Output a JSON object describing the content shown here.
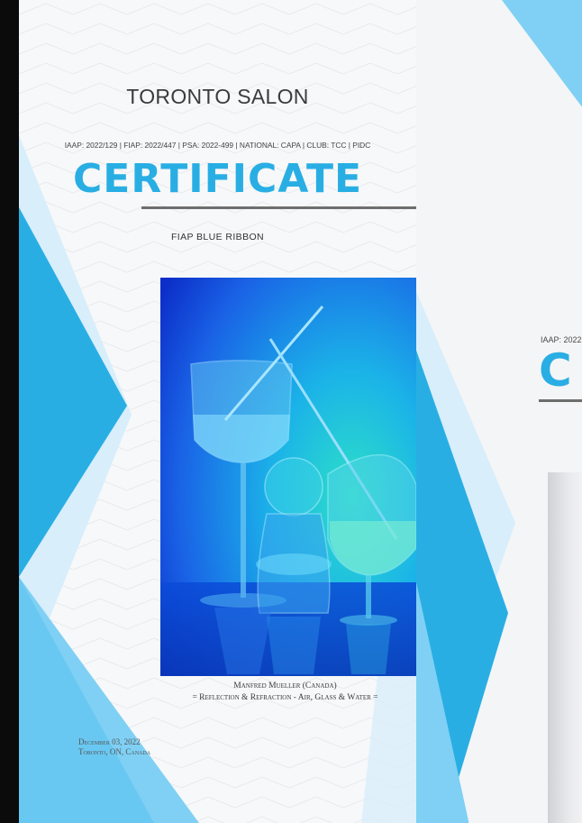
{
  "front_certificate": {
    "salon_name": "TORONTO SALON",
    "accreditations": "IAAP: 2022/129 | FIAP: 2022/447 | PSA: 2022-499 | NATIONAL: CAPA | CLUB: TCC | PIDC",
    "heading": "CERTIFICATE",
    "award": "FIAP BLUE RIBBON",
    "photo_icon": "glassware-photo",
    "author": "Manfred Mueller (Canada)",
    "work_title": "= Reflection & Refraction - Air, Glass & Water =",
    "date": "December 03, 2022",
    "location": "Toronto, ON, Canada"
  },
  "back_certificate": {
    "accreditations_partial": "IAAP: 2022",
    "heading_partial": "C"
  },
  "colors": {
    "accent_blue": "#29aee4",
    "light_blue": "#7fd0f4",
    "pale_blue": "#d8eefb",
    "rule_gray": "#6e6e6e",
    "text_dark": "#3b3b3b"
  }
}
